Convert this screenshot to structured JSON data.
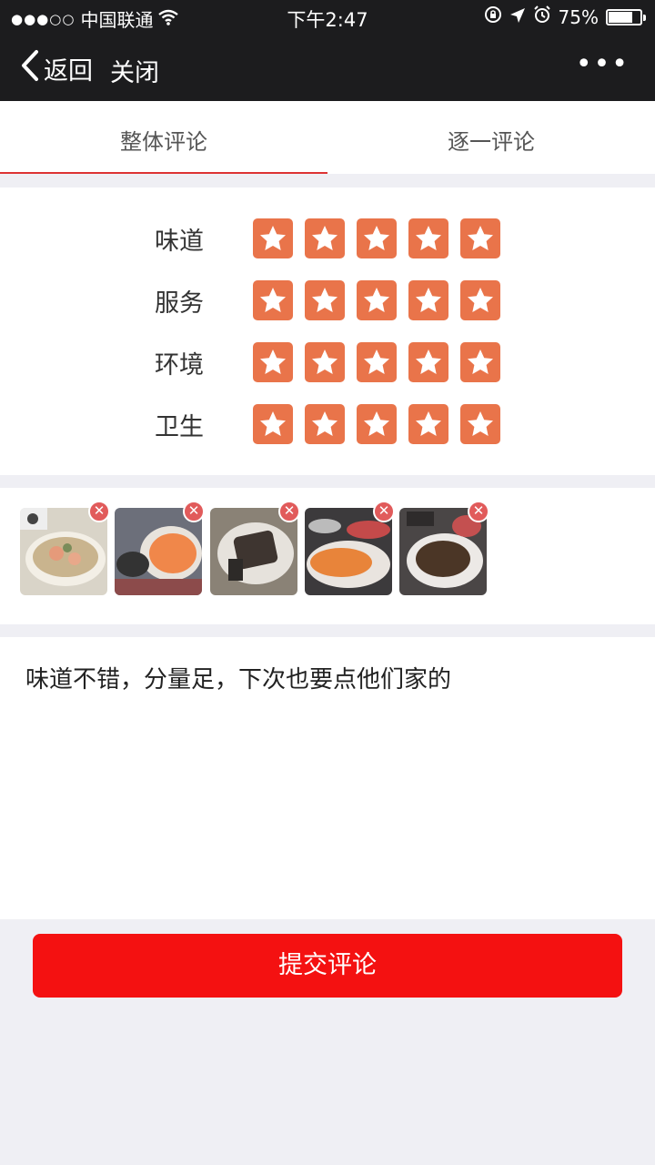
{
  "status_bar": {
    "signal": "●●●○○",
    "carrier": "中国联通",
    "time": "下午2:47",
    "battery": "75%",
    "battery_level": 0.75
  },
  "nav": {
    "back_label": "返回",
    "close_label": "关闭",
    "more_label": "•••"
  },
  "tabs": [
    {
      "label": "整体评论",
      "active": true
    },
    {
      "label": "逐一评论",
      "active": false
    }
  ],
  "ratings": [
    {
      "label": "味道",
      "stars": 5
    },
    {
      "label": "服务",
      "stars": 5
    },
    {
      "label": "环境",
      "stars": 5
    },
    {
      "label": "卫生",
      "stars": 5
    }
  ],
  "photos_count": 5,
  "comment": "味道不错，分量足，下次也要点他们家的",
  "submit_label": "提交评论",
  "colors": {
    "accent": "#f41111",
    "star": "#e9744a",
    "tab_underline": "#dd3333",
    "nav_bg": "#1c1c1e"
  }
}
